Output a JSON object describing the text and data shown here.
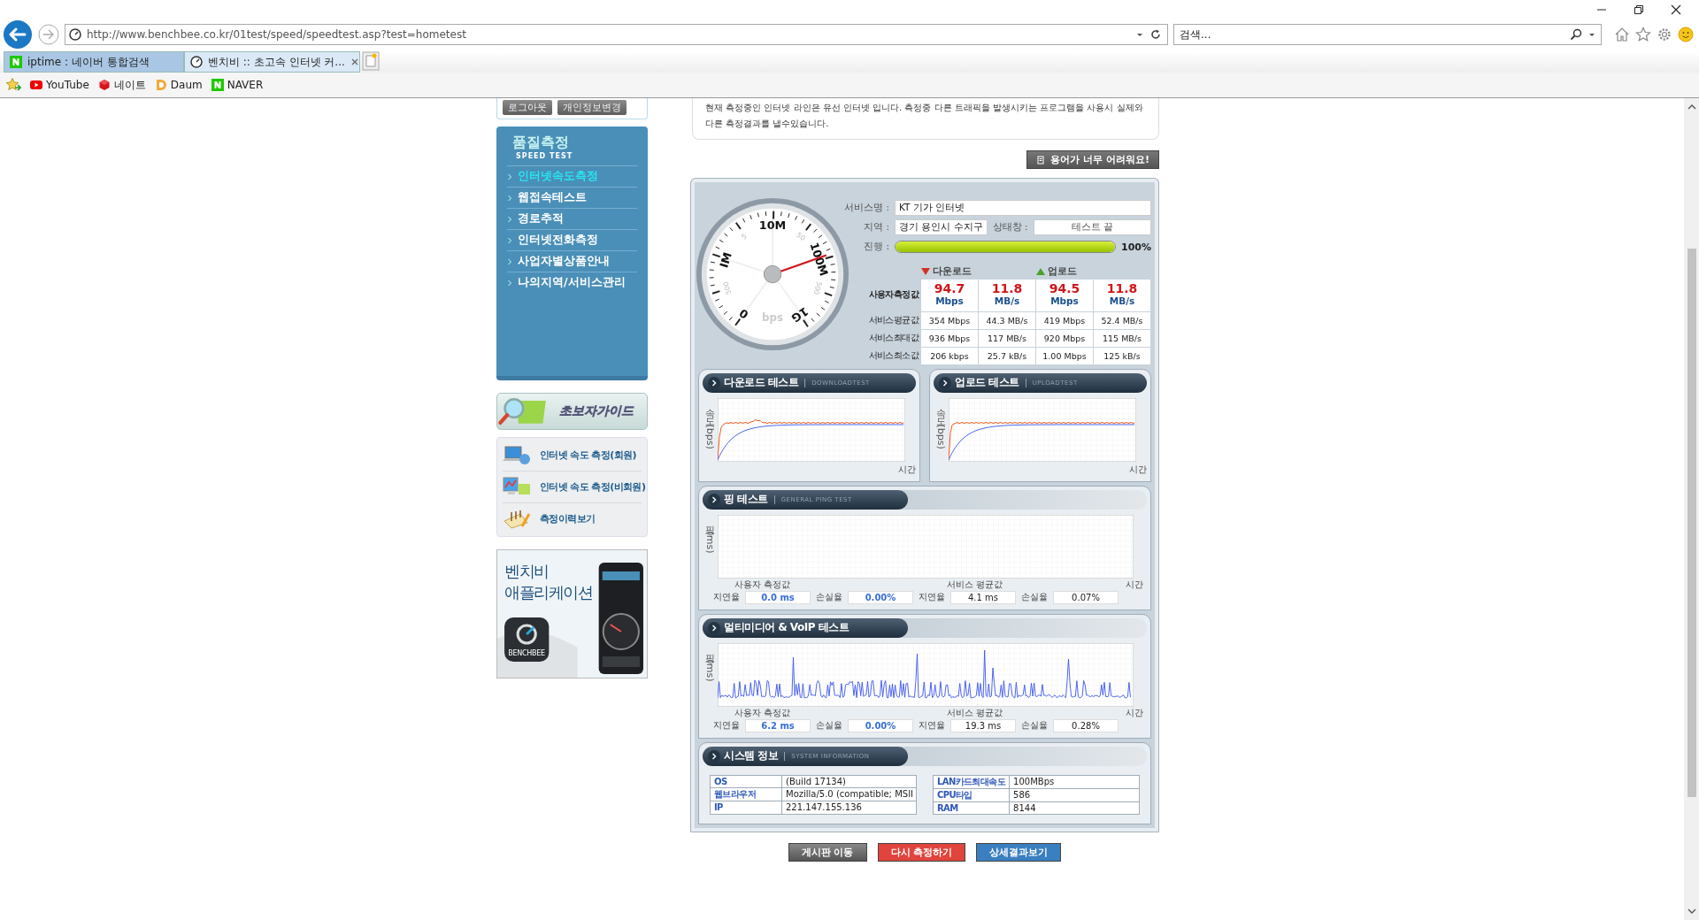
{
  "browser": {
    "url": "http://www.benchbee.co.kr/01test/speed/speedtest.asp?test=hometest",
    "search_placeholder": "검색...",
    "tabs": [
      {
        "label": "iptime : 네이버 통합검색",
        "selected": false,
        "kind": "naver"
      },
      {
        "label": "벤치비 :: 초고속 인터넷 커...",
        "selected": true,
        "kind": "benchbee"
      }
    ],
    "favorites": [
      {
        "label": "YouTube",
        "kind": "youtube"
      },
      {
        "label": "네이트",
        "kind": "nate"
      },
      {
        "label": "Daum",
        "kind": "daum"
      },
      {
        "label": "NAVER",
        "kind": "naver"
      }
    ]
  },
  "sidebar": {
    "account_buttons": [
      "로그아웃",
      "개인정보변경"
    ],
    "menu": {
      "title": "품질측정",
      "subtitle": "SPEED TEST",
      "items": [
        {
          "label": "인터넷속도측정",
          "selected": true
        },
        {
          "label": "웹접속테스트",
          "selected": false
        },
        {
          "label": "경로추적",
          "selected": false
        },
        {
          "label": "인터넷전화측정",
          "selected": false
        },
        {
          "label": "사업자별상품안내",
          "selected": false
        },
        {
          "label": "나의지역/서비스관리",
          "selected": false
        }
      ]
    },
    "guide_banner": "초보자가이드",
    "guide_links": [
      {
        "label": "인터넷 속도 측정(회원)",
        "kind": "laptop"
      },
      {
        "label": "인터넷 속도 측정(비회원)",
        "kind": "monitor"
      },
      {
        "label": "측정이력보기",
        "kind": "notepad"
      }
    ],
    "app_banner": {
      "title_lines": [
        "벤치비",
        "애플리케이션"
      ],
      "icon_label": "BENCHBEE"
    }
  },
  "main": {
    "notice": "현재 측정중인 인터넷 라인은 유선 인터넷 입니다. 측정중 다른 트래픽을 발생시키는 프로그램을 사용시 실제와 다른 측정결과를 낼수있습니다.",
    "help_button": "용어가 너무 어려워요!",
    "info": {
      "service_label": "서비스명 :",
      "service": "KT 기가 인터넷",
      "region_label": "지역 :",
      "region": "경기 용인시 수지구",
      "status_label": "상태창 :",
      "status": "테스트 끝",
      "progress_label": "진행 :",
      "progress": {
        "level": 1.0,
        "text": "100%"
      }
    },
    "gauge": {
      "labels": [
        "IM",
        "5",
        "10M",
        "50",
        "100M",
        "500",
        "1G",
        "0",
        "500"
      ],
      "unit": "bps",
      "level": 0.74
    },
    "results": {
      "headers": [
        {
          "label": "다운로드",
          "kind": "down"
        },
        {
          "label": "업로드",
          "kind": "up"
        }
      ],
      "rows": [
        {
          "label": "사용자측정값",
          "kind": "user",
          "cells": [
            {
              "value": "94.7",
              "unit": "Mbps"
            },
            {
              "value": "11.8",
              "unit": "MB/s"
            },
            {
              "value": "94.5",
              "unit": "Mbps"
            },
            {
              "value": "11.8",
              "unit": "MB/s"
            }
          ]
        },
        {
          "label": "서비스평균값",
          "kind": "service",
          "cells": [
            {
              "value": "354 Mbps"
            },
            {
              "value": "44.3 MB/s"
            },
            {
              "value": "419 Mbps"
            },
            {
              "value": "52.4 MB/s"
            }
          ]
        },
        {
          "label": "서비스최대값",
          "kind": "service",
          "cells": [
            {
              "value": "936 Mbps"
            },
            {
              "value": "117 MB/s"
            },
            {
              "value": "920 Mbps"
            },
            {
              "value": "115 MB/s"
            }
          ]
        },
        {
          "label": "서비스최소값",
          "kind": "service",
          "cells": [
            {
              "value": "206 kbps"
            },
            {
              "value": "25.7 kB/s"
            },
            {
              "value": "1.00 Mbps"
            },
            {
              "value": "125 kB/s"
            }
          ]
        }
      ]
    },
    "speed_tests": [
      {
        "title": "다운로드 테스트",
        "subtitle": "DOWNLOADTEST",
        "ylabel": "속도 (bps)",
        "xlabel": "시간",
        "kind": "download"
      },
      {
        "title": "업로드 테스트",
        "subtitle": "UPLOADTEST",
        "ylabel": "속도 (bps)",
        "xlabel": "시간",
        "kind": "upload"
      }
    ],
    "latency_tests": [
      {
        "title": "핑 테스트",
        "subtitle": "GENERAL PING TEST",
        "ylabel": "핑 (ms)",
        "xlabel": "시간",
        "kind": "ping",
        "user_label": "사용자 측정값",
        "service_label": "서비스 평균값",
        "stats": [
          {
            "label": "지연율",
            "value": "0.0 ms",
            "kind": "user"
          },
          {
            "label": "손실율",
            "value": "0.00%",
            "kind": "user"
          },
          {
            "label": "지연율",
            "value": "4.1 ms",
            "kind": "service"
          },
          {
            "label": "손실율",
            "value": "0.07%",
            "kind": "service"
          }
        ]
      },
      {
        "title": "멀티미디어 & VoIP 테스트",
        "ylabel": "핑 (ms)",
        "xlabel": "시간",
        "kind": "voip",
        "user_label": "사용자 측정값",
        "service_label": "서비스 평균값",
        "stats": [
          {
            "label": "지연율",
            "value": "6.2 ms",
            "kind": "user"
          },
          {
            "label": "손실율",
            "value": "0.00%",
            "kind": "user"
          },
          {
            "label": "지연율",
            "value": "19.3 ms",
            "kind": "service"
          },
          {
            "label": "손실율",
            "value": "0.28%",
            "kind": "service"
          }
        ]
      }
    ],
    "system": {
      "title": "시스템 정보",
      "subtitle": "SYSTEM INFORMATION",
      "left": [
        {
          "key": "OS",
          "value": "(Build 17134)"
        },
        {
          "key": "웹브라우저",
          "value": "Mozilla/5.0 (compatible; MSII"
        },
        {
          "key": "IP",
          "value": "221.147.155.136"
        }
      ],
      "right": [
        {
          "key": "LAN카드최대속도",
          "value": "100MBps"
        },
        {
          "key": "CPU타입",
          "value": "586"
        },
        {
          "key": "RAM",
          "value": "8144"
        }
      ]
    },
    "bottom_buttons": [
      {
        "label": "게시판 이동",
        "kind": "gray"
      },
      {
        "label": "다시 측정하기",
        "kind": "red"
      },
      {
        "label": "상세결과보기",
        "kind": "blue"
      }
    ]
  }
}
